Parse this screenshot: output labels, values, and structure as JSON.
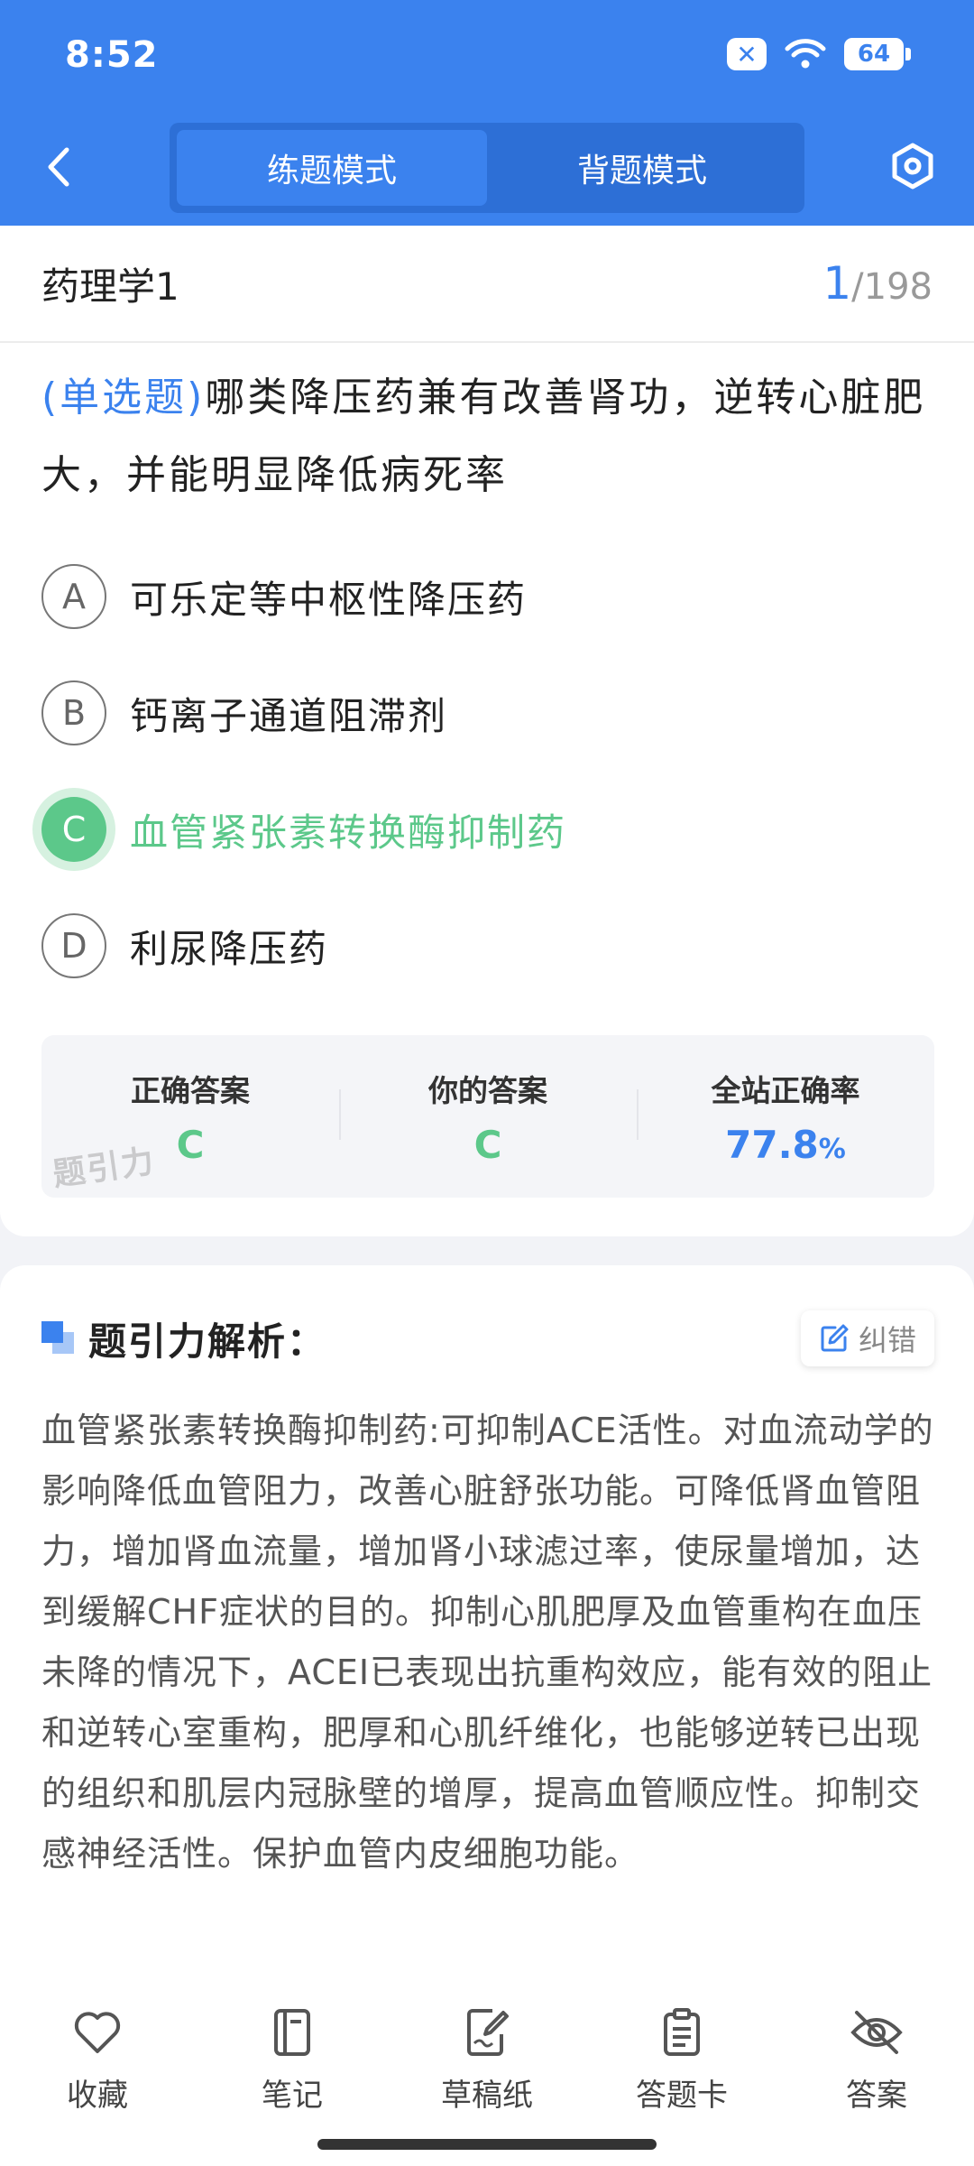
{
  "status": {
    "time": "8:52",
    "battery": "64"
  },
  "header": {
    "tabs": [
      {
        "label": "练题模式",
        "active": true
      },
      {
        "label": "背题模式",
        "active": false
      }
    ]
  },
  "subject": {
    "name": "药理学1",
    "current": "1",
    "total": "/198"
  },
  "question": {
    "type": "(单选题)",
    "text": "哪类降压药兼有改善肾功，逆转心脏肥大，并能明显降低病死率"
  },
  "options": [
    {
      "letter": "A",
      "text": "可乐定等中枢性降压药"
    },
    {
      "letter": "B",
      "text": "钙离子通道阻滞剂"
    },
    {
      "letter": "C",
      "text": "血管紧张素转换酶抑制药",
      "correct": true
    },
    {
      "letter": "D",
      "text": "利尿降压药"
    }
  ],
  "answer_summary": {
    "correct_label": "正确答案",
    "correct_value": "C",
    "yours_label": "你的答案",
    "yours_value": "C",
    "rate_label": "全站正确率",
    "rate_value": "77.8",
    "rate_unit": "%",
    "watermark": "题引力"
  },
  "analysis": {
    "title": "题引力解析：",
    "fix_label": "纠错",
    "text": "血管紧张素转换酶抑制药:可抑制ACE活性。对血流动学的影响降低血管阻力，改善心脏舒张功能。可降低肾血管阻力，增加肾血流量，增加肾小球滤过率，使尿量增加，达到缓解CHF症状的目的。抑制心肌肥厚及血管重构在血压未降的情况下，ACEI已表现出抗重构效应，能有效的阻止和逆转心室重构，肥厚和心肌纤维化，也能够逆转已出现的组织和肌层内冠脉壁的增厚，提高血管顺应性。抑制交感神经活性。保护血管内皮细胞功能。"
  },
  "bottom_nav": [
    {
      "label": "收藏",
      "icon": "heart-icon"
    },
    {
      "label": "笔记",
      "icon": "notebook-icon"
    },
    {
      "label": "草稿纸",
      "icon": "draft-paper-icon"
    },
    {
      "label": "答题卡",
      "icon": "answer-card-icon"
    },
    {
      "label": "答案",
      "icon": "eye-off-icon"
    }
  ],
  "colors": {
    "primary": "#3b82ee",
    "correct": "#5cc88a"
  }
}
